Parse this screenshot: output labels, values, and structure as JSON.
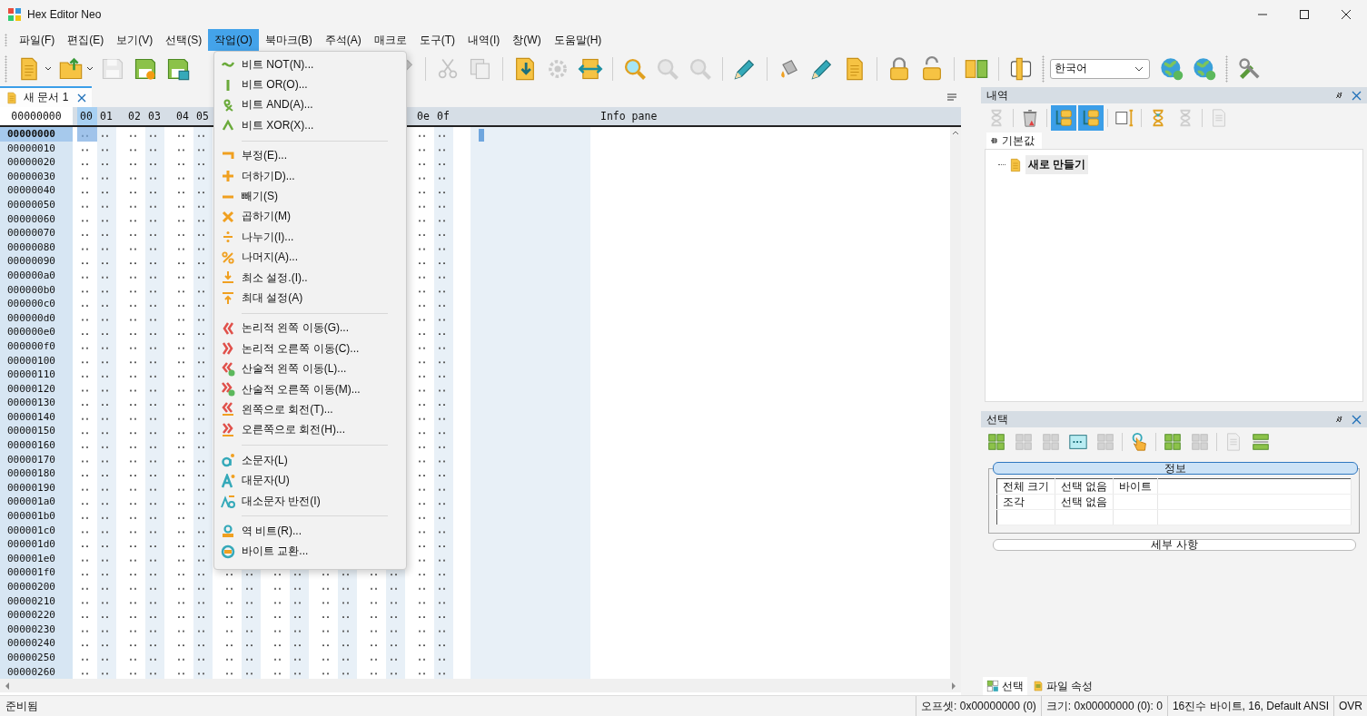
{
  "window": {
    "title": "Hex Editor Neo"
  },
  "menu_bar": [
    {
      "label": "파일(F)",
      "selected": false
    },
    {
      "label": "편집(E)",
      "selected": false
    },
    {
      "label": "보기(V)",
      "selected": false
    },
    {
      "label": "선택(S)",
      "selected": false
    },
    {
      "label": "작업(O)",
      "selected": true
    },
    {
      "label": "북마크(B)",
      "selected": false
    },
    {
      "label": "주석(A)",
      "selected": false
    },
    {
      "label": "매크로",
      "selected": false
    },
    {
      "label": "도구(T)",
      "selected": false
    },
    {
      "label": "내역(I)",
      "selected": false
    },
    {
      "label": "창(W)",
      "selected": false
    },
    {
      "label": "도움말(H)",
      "selected": false
    }
  ],
  "toolbar": [
    {
      "kind": "split",
      "disabled": false
    },
    {
      "kind": "split",
      "disabled": false
    },
    {
      "kind": "button",
      "disabled": true
    },
    {
      "kind": "button",
      "disabled": false
    },
    {
      "kind": "button",
      "disabled": false
    },
    {
      "kind": "button",
      "disabled": true
    },
    {
      "kind": "separator"
    },
    {
      "kind": "button",
      "disabled": true
    },
    {
      "kind": "button",
      "disabled": true
    },
    {
      "kind": "separator"
    },
    {
      "kind": "button",
      "disabled": false
    },
    {
      "kind": "button",
      "disabled": true
    },
    {
      "kind": "button",
      "disabled": false
    },
    {
      "kind": "separator"
    },
    {
      "kind": "button",
      "disabled": false
    },
    {
      "kind": "button",
      "disabled": true
    },
    {
      "kind": "button",
      "disabled": true
    },
    {
      "kind": "separator"
    },
    {
      "kind": "button",
      "disabled": false
    },
    {
      "kind": "separator"
    },
    {
      "kind": "button",
      "disabled": false
    },
    {
      "kind": "button",
      "disabled": false
    },
    {
      "kind": "button",
      "disabled": false
    },
    {
      "kind": "separator"
    },
    {
      "kind": "button",
      "disabled": false
    },
    {
      "kind": "button",
      "disabled": false
    },
    {
      "kind": "separator"
    },
    {
      "kind": "button",
      "disabled": false
    },
    {
      "kind": "separator"
    },
    {
      "kind": "button",
      "disabled": false
    },
    {
      "kind": "grip"
    },
    {
      "kind": "select",
      "value": "한국어"
    },
    {
      "kind": "button",
      "disabled": false
    },
    {
      "kind": "button",
      "disabled": false
    },
    {
      "kind": "grip"
    },
    {
      "kind": "button",
      "disabled": false
    }
  ],
  "document_tabs": [
    {
      "label": "새 문서 1",
      "selected": true
    }
  ],
  "hex_view": {
    "corner": "00000000",
    "columns": [
      {
        "label": "00",
        "selected": true
      },
      {
        "label": "01",
        "selected": false
      },
      {
        "label": "02",
        "selected": false
      },
      {
        "label": "03",
        "selected": false
      },
      {
        "label": "04",
        "selected": false
      },
      {
        "label": "05",
        "selected": false
      },
      {
        "label": "0e",
        "selected": false
      },
      {
        "label": "0f",
        "selected": false
      }
    ],
    "info_header": "Info pane",
    "addresses": [
      {
        "label": "00000000",
        "selected": true
      },
      {
        "label": "00000010",
        "selected": false
      },
      {
        "label": "00000020",
        "selected": false
      },
      {
        "label": "00000030",
        "selected": false
      },
      {
        "label": "00000040",
        "selected": false
      },
      {
        "label": "00000050",
        "selected": false
      },
      {
        "label": "00000060",
        "selected": false
      },
      {
        "label": "00000070",
        "selected": false
      },
      {
        "label": "00000080",
        "selected": false
      },
      {
        "label": "00000090",
        "selected": false
      },
      {
        "label": "000000a0",
        "selected": false
      },
      {
        "label": "000000b0",
        "selected": false
      },
      {
        "label": "000000c0",
        "selected": false
      },
      {
        "label": "000000d0",
        "selected": false
      },
      {
        "label": "000000e0",
        "selected": false
      },
      {
        "label": "000000f0",
        "selected": false
      },
      {
        "label": "00000100",
        "selected": false
      },
      {
        "label": "00000110",
        "selected": false
      },
      {
        "label": "00000120",
        "selected": false
      },
      {
        "label": "00000130",
        "selected": false
      },
      {
        "label": "00000140",
        "selected": false
      },
      {
        "label": "00000150",
        "selected": false
      },
      {
        "label": "00000160",
        "selected": false
      },
      {
        "label": "00000170",
        "selected": false
      },
      {
        "label": "00000180",
        "selected": false
      },
      {
        "label": "00000190",
        "selected": false
      },
      {
        "label": "000001a0",
        "selected": false
      },
      {
        "label": "000001b0",
        "selected": false
      },
      {
        "label": "000001c0",
        "selected": false
      },
      {
        "label": "000001d0",
        "selected": false
      },
      {
        "label": "000001e0",
        "selected": false
      },
      {
        "label": "000001f0",
        "selected": false
      },
      {
        "label": "00000200",
        "selected": false
      },
      {
        "label": "00000210",
        "selected": false
      },
      {
        "label": "00000220",
        "selected": false
      },
      {
        "label": "00000230",
        "selected": false
      },
      {
        "label": "00000240",
        "selected": false
      },
      {
        "label": "00000250",
        "selected": false
      },
      {
        "label": "00000260",
        "selected": false
      }
    ]
  },
  "dropdown_menu": [
    {
      "kind": "item",
      "label": "비트 NOT(N)..."
    },
    {
      "kind": "item",
      "label": "비트 OR(O)..."
    },
    {
      "kind": "item",
      "label": "비트 AND(A)..."
    },
    {
      "kind": "item",
      "label": "비트 XOR(X)..."
    },
    {
      "kind": "separator"
    },
    {
      "kind": "item",
      "label": "부정(E)..."
    },
    {
      "kind": "item",
      "label": "더하기D)..."
    },
    {
      "kind": "item",
      "label": "빼기(S)"
    },
    {
      "kind": "item",
      "label": "곱하기(M)"
    },
    {
      "kind": "item",
      "label": "나누기(I)..."
    },
    {
      "kind": "item",
      "label": "나머지(A)..."
    },
    {
      "kind": "item",
      "label": "최소 설정.(I).."
    },
    {
      "kind": "item",
      "label": "최대 설정(A)"
    },
    {
      "kind": "separator"
    },
    {
      "kind": "item",
      "label": "논리적 왼쪽 이동(G)..."
    },
    {
      "kind": "item",
      "label": "논리적 오른쪽 이동(C)..."
    },
    {
      "kind": "item",
      "label": "산술적 왼쪽 이동(L)..."
    },
    {
      "kind": "item",
      "label": "산술적 오른쪽 이동(M)..."
    },
    {
      "kind": "item",
      "label": "왼쪽으로 회전(T)..."
    },
    {
      "kind": "item",
      "label": "오른쪽으로 회전(H)..."
    },
    {
      "kind": "separator"
    },
    {
      "kind": "item",
      "label": "소문자(L)"
    },
    {
      "kind": "item",
      "label": "대문자(U)"
    },
    {
      "kind": "item",
      "label": "대소문자 반전(I)"
    },
    {
      "kind": "separator"
    },
    {
      "kind": "item",
      "label": "역 비트(R)..."
    },
    {
      "kind": "item",
      "label": "바이트 교환..."
    }
  ],
  "history_panel": {
    "title": "내역",
    "toolbar": [
      {
        "kind": "button",
        "disabled": true,
        "selected": false
      },
      {
        "kind": "separator"
      },
      {
        "kind": "button",
        "disabled": false,
        "selected": false
      },
      {
        "kind": "separator"
      },
      {
        "kind": "button",
        "disabled": false,
        "selected": true
      },
      {
        "kind": "button",
        "disabled": false,
        "selected": true
      },
      {
        "kind": "separator"
      },
      {
        "kind": "button",
        "disabled": false,
        "selected": false
      },
      {
        "kind": "separator"
      },
      {
        "kind": "button",
        "disabled": false,
        "selected": false
      },
      {
        "kind": "button",
        "disabled": true,
        "selected": false
      },
      {
        "kind": "separator"
      },
      {
        "kind": "button",
        "disabled": true,
        "selected": false
      }
    ],
    "tabs": [
      {
        "label": "기본값",
        "selected": true
      }
    ],
    "tree": [
      {
        "label": "새로 만들기",
        "selected": true
      }
    ]
  },
  "selection_panel": {
    "title": "선택",
    "toolbar": [
      {
        "kind": "button",
        "disabled": false
      },
      {
        "kind": "button",
        "disabled": true
      },
      {
        "kind": "button",
        "disabled": true
      },
      {
        "kind": "button",
        "disabled": false
      },
      {
        "kind": "button",
        "disabled": true
      },
      {
        "kind": "separator"
      },
      {
        "kind": "button",
        "disabled": false
      },
      {
        "kind": "separator"
      },
      {
        "kind": "button",
        "disabled": false
      },
      {
        "kind": "button",
        "disabled": true
      },
      {
        "kind": "separator"
      },
      {
        "kind": "button",
        "disabled": true
      },
      {
        "kind": "button",
        "disabled": false
      }
    ],
    "info_header": "정보",
    "info_rows": [
      {
        "cells": [
          "전체 크기",
          "선택 없음",
          "바이트"
        ]
      },
      {
        "cells": [
          "조각",
          "선택 없음"
        ]
      }
    ],
    "details_header": "세부 사항"
  },
  "panel_tabs": [
    {
      "label": "선택",
      "selected": true
    },
    {
      "label": "파일 속성",
      "selected": false
    }
  ],
  "status_bar": {
    "message": "준비됨",
    "fields": [
      "오프셋: 0x00000000 (0)",
      "크기: 0x00000000 (0): 0",
      "16진수 바이트, 16, Default ANSI",
      "OVR"
    ]
  }
}
